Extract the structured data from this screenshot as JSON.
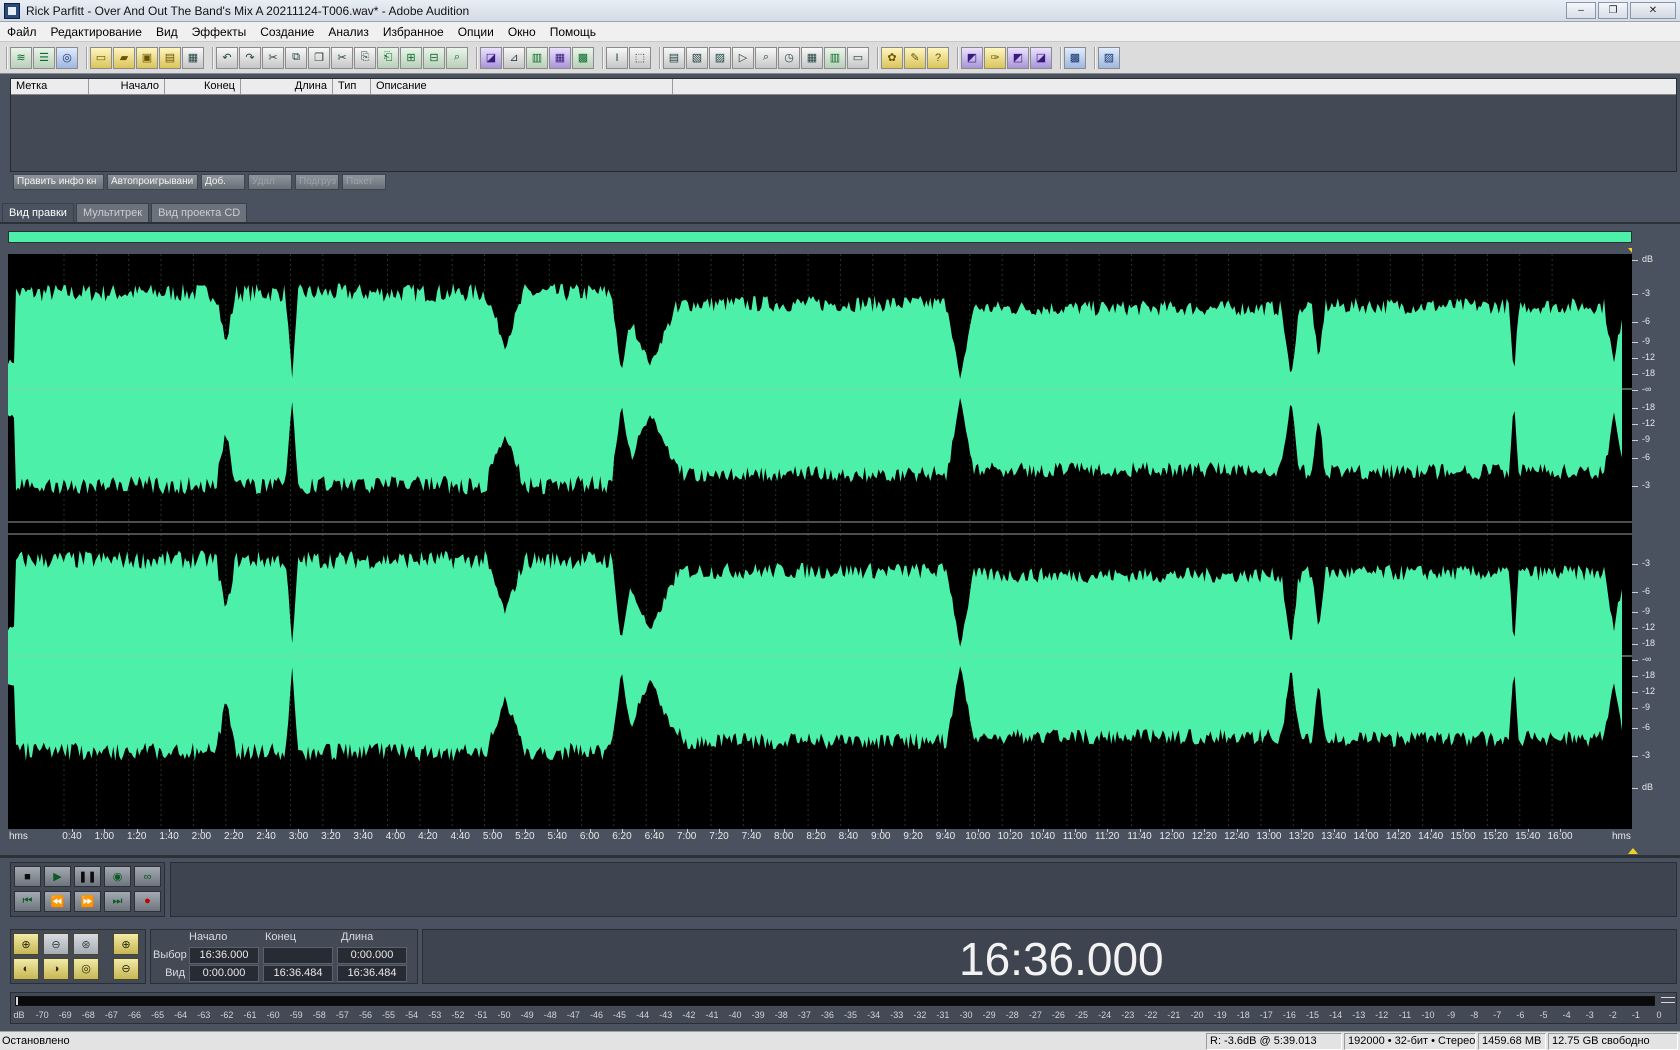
{
  "window": {
    "title": "Rick Parfitt - Over And Out The Band's Mix  A 20211124-T006.wav* - Adobe Audition",
    "controls": [
      "–",
      "❐",
      "✕"
    ]
  },
  "menu": [
    "Файл",
    "Редактирование",
    "Вид",
    "Эффекты",
    "Создание",
    "Анализ",
    "Избранное",
    "Опции",
    "Окно",
    "Помощь"
  ],
  "markers": {
    "columns": [
      "Метка",
      "Начало",
      "Конец",
      "Длина",
      "Тип",
      "Описание"
    ],
    "buttons": [
      {
        "label": "Править инфо кн",
        "enabled": true
      },
      {
        "label": "Автопроигрывани",
        "enabled": true
      },
      {
        "label": "Доб.",
        "enabled": true
      },
      {
        "label": "Удал",
        "enabled": false
      },
      {
        "label": "Подгруз",
        "enabled": false
      },
      {
        "label": "Пакет",
        "enabled": false
      }
    ]
  },
  "tabs": [
    {
      "label": "Вид правки",
      "active": true
    },
    {
      "label": "Мультитрек",
      "active": false
    },
    {
      "label": "Вид проекта CD",
      "active": false
    }
  ],
  "waveform": {
    "color": "#4df0a8",
    "background": "#000000",
    "channels": 2,
    "db_scale_top": [
      "dB",
      "-3",
      "-6",
      "-9",
      "-12",
      "-18",
      "-∞",
      "-18",
      "-12",
      "-9",
      "-6",
      "-3"
    ],
    "db_scale_bottom": [
      "-3",
      "-6",
      "-9",
      "-12",
      "-18",
      "-∞",
      "-18",
      "-12",
      "-9",
      "-6",
      "-3",
      "dB"
    ]
  },
  "time_ruler": {
    "unit_label": "hms",
    "labels": [
      "0:40",
      "1:00",
      "1:20",
      "1:40",
      "2:00",
      "2:20",
      "2:40",
      "3:00",
      "3:20",
      "3:40",
      "4:00",
      "4:20",
      "4:40",
      "5:00",
      "5:20",
      "5:40",
      "6:00",
      "6:20",
      "6:40",
      "7:00",
      "7:20",
      "7:40",
      "8:00",
      "8:20",
      "8:40",
      "9:00",
      "9:20",
      "9:40",
      "10:00",
      "10:20",
      "10:40",
      "11:00",
      "11:20",
      "11:40",
      "12:00",
      "12:20",
      "12:40",
      "13:00",
      "13:20",
      "13:40",
      "14:00",
      "14:20",
      "14:40",
      "15:00",
      "15:20",
      "15:40",
      "16:00"
    ]
  },
  "transport": {
    "buttons": [
      "stop",
      "play",
      "pause",
      "play-to-end",
      "loop",
      "go-to-start",
      "rewind",
      "fast-forward",
      "go-to-end",
      "record"
    ]
  },
  "zoom": {
    "buttons": [
      "zoom-in-horizontal",
      "zoom-out-horizontal",
      "zoom-out-full",
      "zoom-in-vertical",
      "zoom-to-left",
      "zoom-to-right",
      "zoom-selection",
      "zoom-out-vertical"
    ]
  },
  "selection": {
    "col_headers": [
      "Начало",
      "Конец",
      "Длина"
    ],
    "rows": [
      {
        "label": "Выбор",
        "start": "16:36.000",
        "end": "",
        "length": "0:00.000"
      },
      {
        "label": "Вид",
        "start": "0:00.000",
        "end": "16:36.484",
        "length": "16:36.484"
      }
    ]
  },
  "time_display": "16:36.000",
  "level_meter": {
    "labels": [
      "dB",
      "-70",
      "-69",
      "-68",
      "-67",
      "-66",
      "-65",
      "-64",
      "-63",
      "-62",
      "-61",
      "-60",
      "-59",
      "-58",
      "-57",
      "-56",
      "-55",
      "-54",
      "-53",
      "-52",
      "-51",
      "-50",
      "-49",
      "-48",
      "-47",
      "-46",
      "-45",
      "-44",
      "-43",
      "-42",
      "-41",
      "-40",
      "-39",
      "-38",
      "-37",
      "-36",
      "-35",
      "-34",
      "-33",
      "-32",
      "-31",
      "-30",
      "-29",
      "-28",
      "-27",
      "-26",
      "-25",
      "-24",
      "-23",
      "-22",
      "-21",
      "-20",
      "-19",
      "-18",
      "-17",
      "-16",
      "-15",
      "-14",
      "-13",
      "-12",
      "-11",
      "-10",
      "-9",
      "-8",
      "-7",
      "-6",
      "-5",
      "-4",
      "-3",
      "-2",
      "-1",
      "0"
    ]
  },
  "status": {
    "text": "Остановлено",
    "level": "R: -3.6dB @   5:39.013",
    "format": "192000 • 32-бит • Стерео",
    "size": "1459.68 MB",
    "free": "12.75 GB свободно"
  }
}
